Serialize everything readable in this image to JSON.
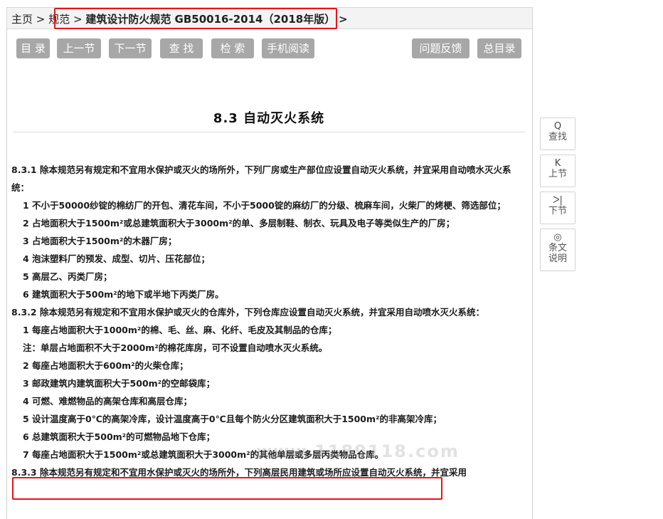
{
  "breadcrumb": {
    "home": "主页",
    "sep1": ">",
    "standards": "规范",
    "sep2": ">",
    "current": "建筑设计防火规范 GB50016-2014（2018年版）",
    "sep3": ">"
  },
  "toolbar": {
    "contents": "目 录",
    "prev": "上一节",
    "next": "下一节",
    "find": "查 找",
    "search": "检 索",
    "mobile": "手机阅读",
    "feedback": "问题反馈",
    "index": "总目录"
  },
  "section": {
    "title": "8.3 自动灭火系统"
  },
  "content": [
    "8.3.1 除本规范另有规定和不宜用水保护或灭火的场所外，下列厂房或生产部位应设置自动灭火系统，并宜采用自动喷水灭火系统：",
    "1 不小于50000纱锭的棉纺厂的开包、清花车间，不小于5000锭的麻纺厂的分级、梳麻车间，火柴厂的烤梗、筛选部位；",
    "2 占地面积大于1500m²或总建筑面积大于3000m²的单、多层制鞋、制衣、玩具及电子等类似生产的厂房；",
    "3 占地面积大于1500m²的木器厂房；",
    "4 泡沫塑料厂的预发、成型、切片、压花部位；",
    "5 高层乙、丙类厂房；",
    "6 建筑面积大于500m²的地下或半地下丙类厂房。",
    "8.3.2 除本规范另有规定和不宜用水保护或灭火的仓库外，下列仓库应设置自动灭火系统，并宜采用自动喷水灭火系统：",
    "1 每座占地面积大于1000m²的棉、毛、丝、麻、化纤、毛皮及其制品的仓库；",
    "注：单层占地面积不大于2000m²的棉花库房，可不设置自动喷水灭火系统。",
    "2 每座占地面积大于600m²的火柴仓库；",
    "3 邮政建筑内建筑面积大于500m²的空邮袋库；",
    "4 可燃、难燃物品的高架仓库和高层仓库；",
    "5 设计温度高于0℃的高架冷库，设计温度高于0℃且每个防火分区建筑面积大于1500m²的非高架冷库；",
    "6 总建筑面积大于500m²的可燃物品地下仓库；",
    "7 每座占地面积大于1500m²或总建筑面积大于3000m²的其他单层或多层丙类物品仓库。",
    "8.3.3 除本规范另有规定和不宜用水保护或灭火的场所外，下列高层民用建筑或场所应设置自动灭火系统，并宜采用"
  ],
  "watermark": "www.1189118.com",
  "side": {
    "find": {
      "icon": "Q",
      "label": "查找"
    },
    "prev": {
      "icon": "K",
      "label": "上节"
    },
    "next": {
      "icon": "ᐳ|",
      "label": "下节"
    },
    "notes": {
      "icon": "◎",
      "label1": "条文",
      "label2": "说明"
    }
  }
}
